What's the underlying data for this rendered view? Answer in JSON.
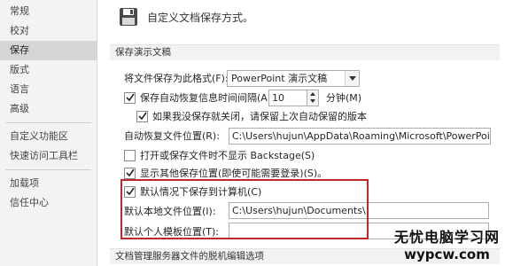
{
  "sidebar": {
    "items": [
      {
        "label": "常规"
      },
      {
        "label": "校对"
      },
      {
        "label": "保存",
        "active": true
      },
      {
        "label": "版式"
      },
      {
        "label": "语言"
      },
      {
        "label": "高级"
      },
      {
        "label": "自定义功能区"
      },
      {
        "label": "快速访问工具栏"
      },
      {
        "label": "加载项"
      },
      {
        "label": "信任中心"
      }
    ]
  },
  "header": {
    "icon": "floppy-disk-icon",
    "text": "自定义文档保存方式。"
  },
  "section_save_title": "保存演示文稿",
  "format_label": "将文件保存为此格式(F):",
  "format_value": "PowerPoint 演示文稿",
  "autorecover": {
    "label": "保存自动恢复信息时间间隔(A)",
    "value": "10",
    "unit": "分钟(M)",
    "checked": true
  },
  "keep_last": {
    "label": "如果我没保存就关闭，请保留上次自动保留的版本",
    "checked": true
  },
  "autorecover_location": {
    "label": "自动恢复文件位置(R):",
    "value": "C:\\Users\\hujun\\AppData\\Roaming\\Microsoft\\PowerPoint\\"
  },
  "no_backstage": {
    "label": "打开或保存文件时不显示 Backstage(S)",
    "checked": false
  },
  "show_additional": {
    "label": "显示其他保存位置(即使可能需要登录)(S)。",
    "checked": true
  },
  "save_to_computer": {
    "label": "默认情况下保存到计算机(C)",
    "checked": true
  },
  "default_local": {
    "label": "默认本地文件位置(I):",
    "value": "C:\\Users\\hujun\\Documents\\"
  },
  "default_template": {
    "label": "默认个人模板位置(T):",
    "value": ""
  },
  "section_offline_title": "文档管理服务器文件的脱机编辑选项",
  "watermark": {
    "line1": "无忧电脑学习网",
    "line2": "wypcw.com"
  },
  "colors": {
    "highlight": "#c0272d",
    "sidebar_active": "#d5d5d5"
  }
}
